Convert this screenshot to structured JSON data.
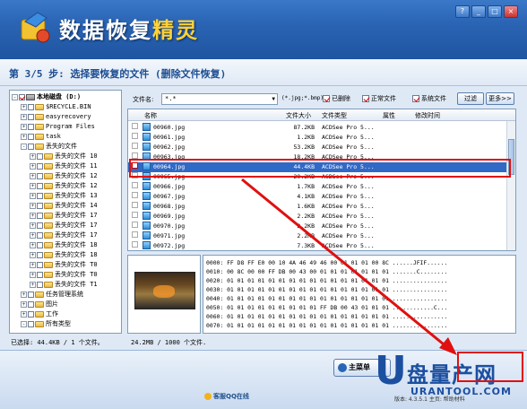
{
  "app": {
    "title_main": "数据恢复",
    "title_accent": "精灵"
  },
  "window_buttons": [
    "?",
    "_",
    "□",
    "×"
  ],
  "step": {
    "text": "第 3/5 步: 选择要恢复的文件 (删除文件恢复)"
  },
  "tree": {
    "items": [
      {
        "label": "本地磁盘 (D:)",
        "level": 0,
        "expander": "-",
        "checked": true,
        "icon": "drive-icon",
        "bold": true
      },
      {
        "label": "$RECYCLE.BIN",
        "level": 1,
        "expander": "+",
        "checked": false,
        "icon": "folder-icon"
      },
      {
        "label": "easyrecovery",
        "level": 1,
        "expander": "+",
        "checked": false,
        "icon": "folder-icon"
      },
      {
        "label": "Program Files",
        "level": 1,
        "expander": "+",
        "checked": false,
        "icon": "folder-icon"
      },
      {
        "label": "task",
        "level": 1,
        "expander": "+",
        "checked": false,
        "icon": "folder-icon"
      },
      {
        "label": "丢失的文件",
        "level": 1,
        "expander": "-",
        "checked": false,
        "icon": "folder-icon"
      },
      {
        "label": "丢失的文件 10",
        "level": 2,
        "expander": "+",
        "checked": false,
        "icon": "folder-icon"
      },
      {
        "label": "丢失的文件 11",
        "level": 2,
        "expander": "+",
        "checked": false,
        "icon": "folder-icon"
      },
      {
        "label": "丢失的文件 12",
        "level": 2,
        "expander": "+",
        "checked": false,
        "icon": "folder-icon"
      },
      {
        "label": "丢失的文件 12",
        "level": 2,
        "expander": "+",
        "checked": false,
        "icon": "folder-icon"
      },
      {
        "label": "丢失的文件 13",
        "level": 2,
        "expander": "+",
        "checked": false,
        "icon": "folder-icon"
      },
      {
        "label": "丢失的文件 14",
        "level": 2,
        "expander": "+",
        "checked": false,
        "icon": "folder-icon"
      },
      {
        "label": "丢失的文件 17",
        "level": 2,
        "expander": "+",
        "checked": false,
        "icon": "folder-icon"
      },
      {
        "label": "丢失的文件 17",
        "level": 2,
        "expander": "+",
        "checked": false,
        "icon": "folder-icon"
      },
      {
        "label": "丢失的文件 17",
        "level": 2,
        "expander": "+",
        "checked": false,
        "icon": "folder-icon"
      },
      {
        "label": "丢失的文件 18",
        "level": 2,
        "expander": "+",
        "checked": false,
        "icon": "folder-icon"
      },
      {
        "label": "丢失的文件 18",
        "level": 2,
        "expander": "+",
        "checked": false,
        "icon": "folder-icon"
      },
      {
        "label": "丢失的文件 T0",
        "level": 2,
        "expander": "+",
        "checked": false,
        "icon": "folder-icon"
      },
      {
        "label": "丢失的文件 T0",
        "level": 2,
        "expander": "+",
        "checked": false,
        "icon": "folder-icon"
      },
      {
        "label": "丢失的文件 T1",
        "level": 2,
        "expander": "+",
        "checked": false,
        "icon": "folder-icon"
      },
      {
        "label": "任务管理系统",
        "level": 1,
        "expander": "+",
        "checked": false,
        "icon": "folder-icon"
      },
      {
        "label": "图片",
        "level": 1,
        "expander": "+",
        "checked": false,
        "icon": "folder-icon"
      },
      {
        "label": "工作",
        "level": 1,
        "expander": "+",
        "checked": false,
        "icon": "folder-icon"
      },
      {
        "label": "所有类型",
        "level": 1,
        "expander": "-",
        "checked": false,
        "icon": "folder-icon"
      }
    ]
  },
  "status": {
    "selected": "已选择: 44.4KB / 1 个文件。",
    "total": "24.2MB / 1000 个文件."
  },
  "filter": {
    "name_label": "文件名:",
    "name_value": "*.*",
    "hint": "(*.jpg;*.bmp)",
    "deleted_label": "已删除",
    "normal_label": "正常文件",
    "system_label": "系统文件",
    "filter_button": "过滤",
    "more_button": "更多>>"
  },
  "filelist": {
    "headers": {
      "name": "名称",
      "size": "文件大小",
      "type": "文件类型",
      "attr": "属性",
      "mtime": "修改时间"
    },
    "rows": [
      {
        "name": "00960.jpg",
        "size": "87.2KB",
        "type": "ACDSee Pro 5...",
        "selected": false
      },
      {
        "name": "00961.jpg",
        "size": "1.2KB",
        "type": "ACDSee Pro 5...",
        "selected": false
      },
      {
        "name": "00962.jpg",
        "size": "53.2KB",
        "type": "ACDSee Pro 5...",
        "selected": false
      },
      {
        "name": "00963.jpg",
        "size": "18.2KB",
        "type": "ACDSee Pro 5...",
        "selected": false
      },
      {
        "name": "00964.jpg",
        "size": "44.4KB",
        "type": "ACDSee Pro 5...",
        "selected": true
      },
      {
        "name": "00965.jpg",
        "size": "20.2KB",
        "type": "ACDSee Pro 5...",
        "selected": false
      },
      {
        "name": "00966.jpg",
        "size": "1.7KB",
        "type": "ACDSee Pro 5...",
        "selected": false
      },
      {
        "name": "00967.jpg",
        "size": "4.1KB",
        "type": "ACDSee Pro 5...",
        "selected": false
      },
      {
        "name": "00968.jpg",
        "size": "1.6KB",
        "type": "ACDSee Pro 5...",
        "selected": false
      },
      {
        "name": "00969.jpg",
        "size": "2.2KB",
        "type": "ACDSee Pro 5...",
        "selected": false
      },
      {
        "name": "00970.jpg",
        "size": "2.2KB",
        "type": "ACDSee Pro 5...",
        "selected": false
      },
      {
        "name": "00971.jpg",
        "size": "2.2KB",
        "type": "ACDSee Pro 5...",
        "selected": false
      },
      {
        "name": "00972.jpg",
        "size": "7.3KB",
        "type": "ACDSee Pro 5...",
        "selected": false
      }
    ]
  },
  "hex": {
    "rows": [
      "0000: FF D8 FF E0 00 10 4A 46 49 46 00 01 01 01 00 8C  ......JFIF......",
      "0010: 00 8C 00 00 FF DB 00 43 00 01 01 01 01 01 01 01  .......C........",
      "0020: 01 01 01 01 01 01 01 01 01 01 01 01 01 01 01 01  ................",
      "0030: 01 01 01 01 01 01 01 01 01 01 01 01 01 01 01 01  ................",
      "0040: 01 01 01 01 01 01 01 01 01 01 01 01 01 01 01 01  ................",
      "0050: 01 01 01 01 01 01 01 01 01 FF DB 00 43 01 01 01  ............C...",
      "0060: 01 01 01 01 01 01 01 01 01 01 01 01 01 01 01 01  ................",
      "0070: 01 01 01 01 01 01 01 01 01 01 01 01 01 01 01 01  ................"
    ]
  },
  "footer": {
    "main_button": "主菜单",
    "qq_label": "客服QQ在线",
    "info": "版本: 4.3.5.1   主页: 帮助材料"
  },
  "watermark": {
    "letter": "U",
    "name": "盘量产网",
    "url": "URANTOOL.COM"
  },
  "colors": {
    "title_blue": "#2a64b4",
    "selection": "#3169c6",
    "annotation_red": "#e01010"
  }
}
